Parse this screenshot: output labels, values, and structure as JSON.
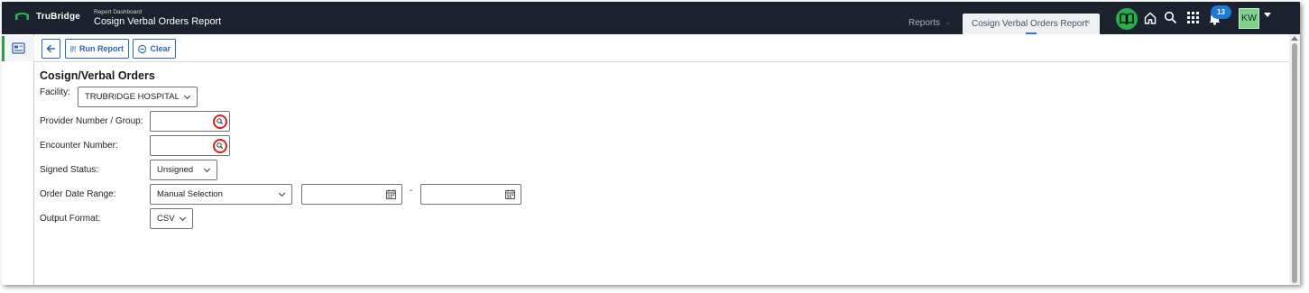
{
  "header": {
    "brand": "TruBridge",
    "breadcrumb_small": "Report Dashboard",
    "breadcrumb_title": "Cosign Verbal Orders Report",
    "tabs": [
      {
        "label": "Reports"
      },
      {
        "label": "Cosign Verbal Orders Report",
        "active": true
      }
    ],
    "notification_count": "13",
    "user_initials": "KW",
    "colors": {
      "bar": "#1d2230",
      "book": "#22b24c",
      "badge": "#1f7ad6",
      "avatar": "#7fd18c"
    },
    "icons": [
      "book-icon",
      "home-icon",
      "search-icon",
      "apps-grid-icon",
      "bell-icon",
      "caret-down-icon"
    ]
  },
  "sidebar": {
    "items": [
      {
        "icon": "report-card-icon",
        "active": true
      }
    ]
  },
  "toolbar": {
    "back_icon": "arrow-left-icon",
    "run_label": "Run Report",
    "run_icon": "qr-code-icon",
    "clear_label": "Clear",
    "clear_icon": "minus-circle-icon"
  },
  "form": {
    "title": "Cosign/Verbal Orders",
    "facility": {
      "label": "Facility:",
      "value": "TRUBRIDGE HOSPITAL"
    },
    "provider": {
      "label": "Provider Number / Group:",
      "value": ""
    },
    "encounter": {
      "label": "Encounter Number:",
      "value": ""
    },
    "signed_status": {
      "label": "Signed Status:",
      "value": "Unsigned"
    },
    "order_date_range": {
      "label": "Order Date Range:",
      "value": "Manual Selection",
      "start": "",
      "end": "",
      "separator": "-"
    },
    "output_format": {
      "label": "Output Format:",
      "value": "CSV"
    }
  }
}
